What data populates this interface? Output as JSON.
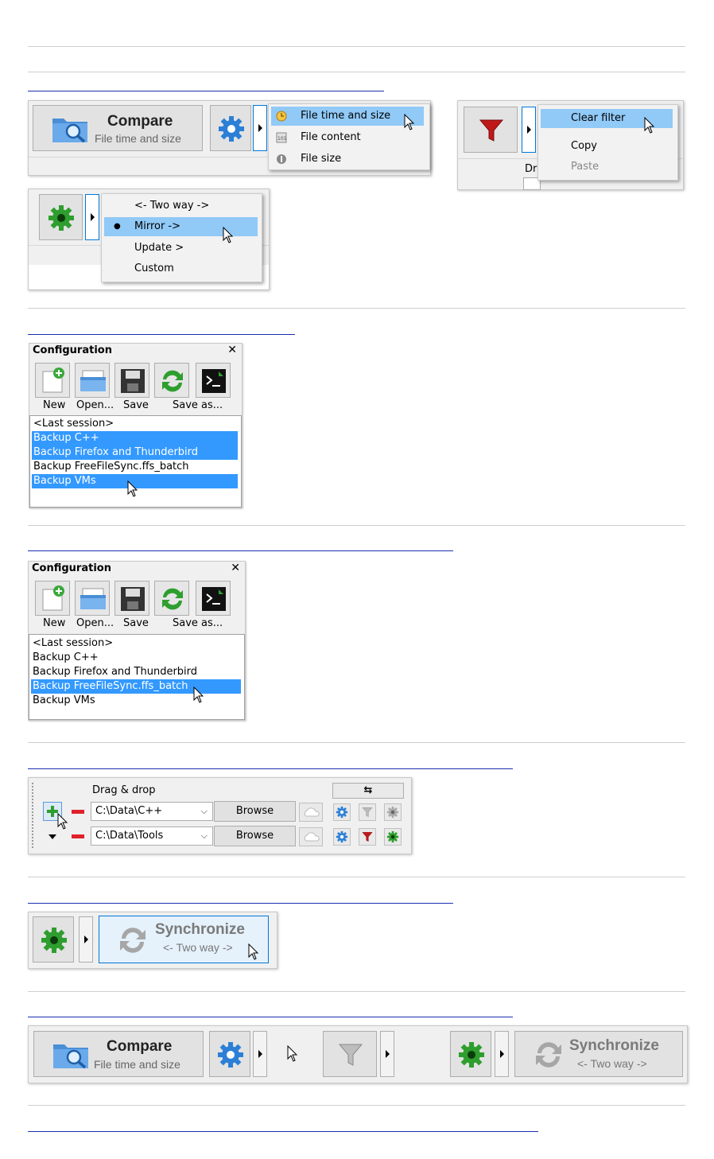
{
  "compare": {
    "title": "Compare",
    "subtitle": "File time and size"
  },
  "compare_menu": {
    "items": [
      "File time and size",
      "File content",
      "File size"
    ]
  },
  "filter_menu": {
    "items": [
      "Clear filter",
      "Copy",
      "Paste"
    ],
    "partial_label": "Dr"
  },
  "sync_menu": {
    "items": [
      "<- Two way ->",
      "Mirror ->",
      "Update >",
      "Custom"
    ]
  },
  "config1": {
    "title": "Configuration",
    "close": "✕",
    "toolbar": [
      "New",
      "Open...",
      "Save",
      "Save as..."
    ],
    "items": [
      "<Last session>",
      "Backup C++",
      "Backup Firefox and Thunderbird",
      "Backup FreeFileSync.ffs_batch",
      "Backup VMs"
    ]
  },
  "config2": {
    "title": "Configuration",
    "close": "✕",
    "toolbar": [
      "New",
      "Open...",
      "Save",
      "Save as..."
    ],
    "items": [
      "<Last session>",
      "Backup C++",
      "Backup Firefox and Thunderbird",
      "Backup FreeFileSync.ffs_batch",
      "Backup VMs"
    ]
  },
  "folders": {
    "header": "Drag & drop",
    "swap": "⇆",
    "rows": [
      {
        "path": "C:\\Data\\C++",
        "browse": "Browse"
      },
      {
        "path": "C:\\Data\\Tools",
        "browse": "Browse"
      }
    ]
  },
  "sync_button": {
    "title": "Synchronize",
    "subtitle": "<- Two way ->"
  },
  "toolbar_bottom": {
    "compare_title": "Compare",
    "compare_subtitle": "File time and size",
    "sync_title": "Synchronize",
    "sync_subtitle": "<- Two way ->"
  },
  "colors": {
    "highlight": "#91c9f7",
    "selection": "#3399ff",
    "link_line": "#1a2fb0",
    "green": "#2e9e2e",
    "red_filter": "#c01818",
    "blue_gear": "#2b7fd6"
  }
}
